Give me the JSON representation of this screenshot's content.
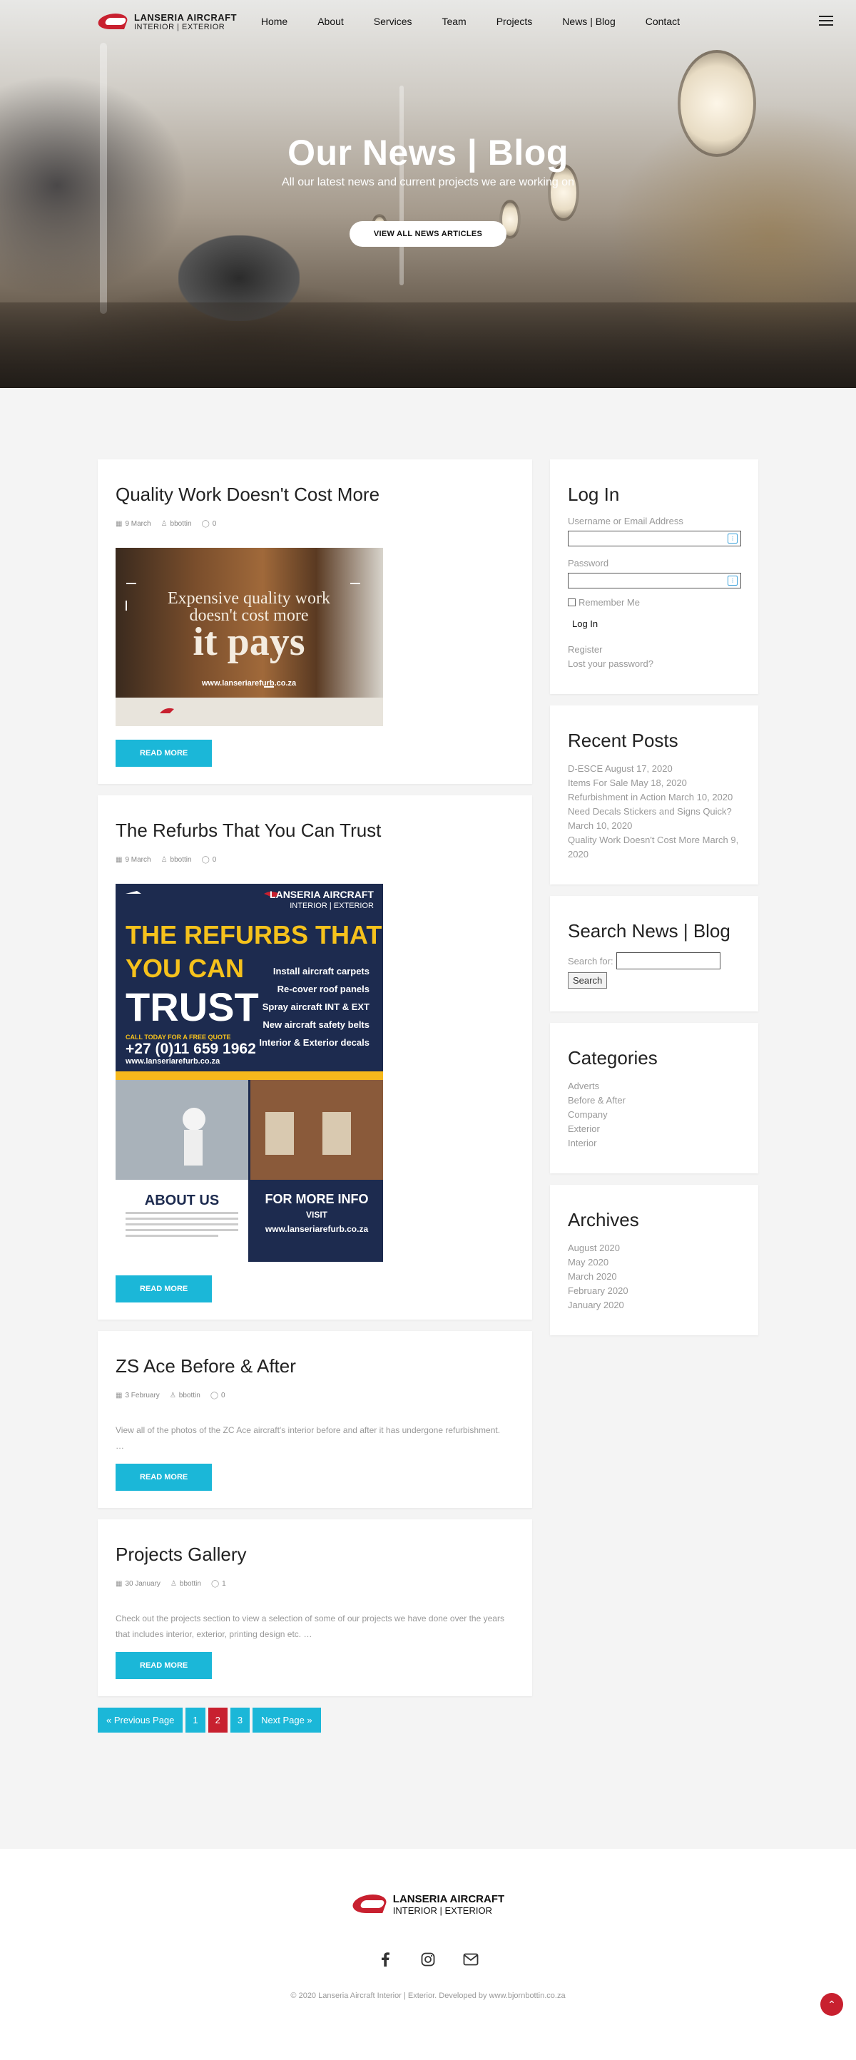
{
  "nav": {
    "logo_line1": "LANSERIA AIRCRAFT",
    "logo_line2": "INTERIOR | EXTERIOR",
    "items": [
      {
        "label": "Home"
      },
      {
        "label": "About"
      },
      {
        "label": "Services"
      },
      {
        "label": "Team"
      },
      {
        "label": "Projects"
      },
      {
        "label": "News | Blog"
      },
      {
        "label": "Contact"
      }
    ]
  },
  "hero": {
    "title": "Our News | Blog",
    "subtitle": "All our latest news and current projects we are working on",
    "button": "VIEW ALL NEWS ARTICLES"
  },
  "posts": [
    {
      "title": "Quality Work Doesn't Cost More",
      "date": "9 March",
      "author": "bbottin",
      "comments": "0",
      "image": {
        "line1": "Expensive quality work",
        "line2": "doesn't cost more",
        "line3": "it pays",
        "url": "www.lanseriarefurb.co.za"
      },
      "read_more": "READ MORE"
    },
    {
      "title": "The Refurbs That You Can Trust",
      "date": "9 March",
      "author": "bbottin",
      "comments": "0",
      "image": {
        "brand": "LANSERIA AIRCRAFT",
        "brand2": "INTERIOR | EXTERIOR",
        "headline1": "THE REFURBS THAT",
        "headline2": "YOU CAN",
        "headline3": "TRUST",
        "services": [
          "Install aircraft carpets",
          "Re-cover roof panels",
          "Spray aircraft INT & EXT",
          "New aircraft safety belts",
          "Interior & Exterior decals"
        ],
        "call": "CALL TODAY FOR A FREE QUOTE",
        "phone": "+27 (0)11 659 1962",
        "url": "www.lanseriarefurb.co.za",
        "about_title": "ABOUT US",
        "info_title": "FOR MORE INFO",
        "info_visit": "VISIT",
        "info_url": "www.lanseriarefurb.co.za"
      },
      "read_more": "READ MORE"
    },
    {
      "title": "ZS Ace Before & After",
      "date": "3 February",
      "author": "bbottin",
      "comments": "0",
      "excerpt": "View all of the photos of the ZC Ace aircraft's interior before and after it has undergone refurbishment.",
      "ellipsis": "…",
      "read_more": "READ MORE"
    },
    {
      "title": "Projects Gallery",
      "date": "30 January",
      "author": "bbottin",
      "comments": "1",
      "excerpt": "Check out the projects section to view a selection of some of our projects we have done over the years that includes interior, exterior, printing design etc. …",
      "read_more": "READ MORE"
    }
  ],
  "pagination": {
    "prev": "« Previous Page",
    "pages": [
      "1",
      "2",
      "3"
    ],
    "current": "2",
    "next": "Next Page »"
  },
  "sidebar": {
    "login": {
      "title": "Log In",
      "username_label": "Username or Email Address",
      "password_label": "Password",
      "remember": "Remember Me",
      "button": "Log In",
      "register": "Register",
      "lost": "Lost your password?"
    },
    "recent": {
      "title": "Recent Posts",
      "items": [
        "D-ESCE August 17, 2020",
        "Items For Sale May 18, 2020",
        "Refurbishment in Action March 10, 2020",
        "Need Decals Stickers and Signs Quick? March 10, 2020",
        "Quality Work Doesn't Cost More March 9, 2020"
      ]
    },
    "search": {
      "title": "Search News | Blog",
      "label": "Search for:",
      "button": "Search"
    },
    "categories": {
      "title": "Categories",
      "items": [
        "Adverts",
        "Before & After",
        "Company",
        "Exterior",
        "Interior"
      ]
    },
    "archives": {
      "title": "Archives",
      "items": [
        "August 2020",
        "May 2020",
        "March 2020",
        "February 2020",
        "January 2020"
      ]
    }
  },
  "footer": {
    "logo_line1": "LANSERIA AIRCRAFT",
    "logo_line2": "INTERIOR | EXTERIOR",
    "copyright": "© 2020 Lanseria Aircraft Interior | Exterior. Developed by www.bjornbottin.co.za",
    "socials": [
      "facebook-icon",
      "instagram-icon",
      "mail-icon"
    ]
  },
  "colors": {
    "accent": "#1bb7d8",
    "brand_red": "#c8202f"
  }
}
